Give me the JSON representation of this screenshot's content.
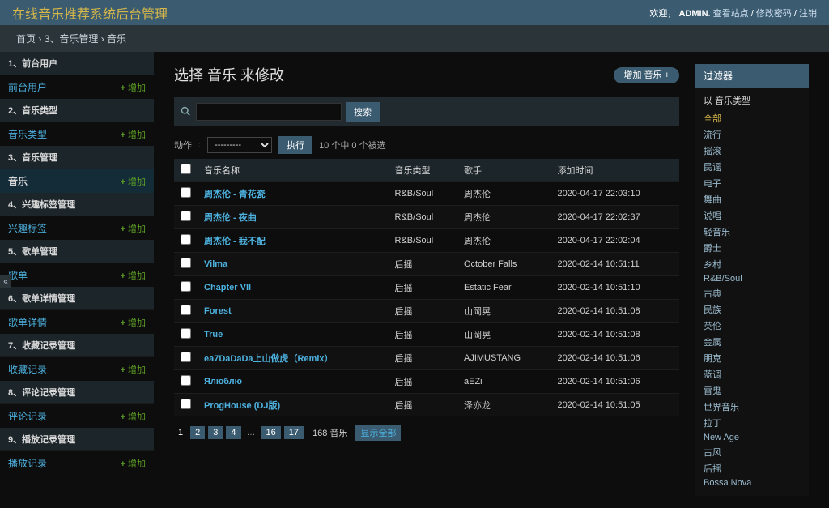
{
  "header": {
    "branding": "在线音乐推荐系统后台管理",
    "welcome": "欢迎，",
    "username": "ADMIN",
    "view_site": "查看站点",
    "change_password": "修改密码",
    "logout": "注销"
  },
  "breadcrumbs": {
    "home": "首页",
    "app": "3、音乐管理",
    "model": "音乐"
  },
  "sidebar": {
    "groups": [
      {
        "caption": "1、前台用户",
        "models": [
          {
            "name": "前台用户",
            "add": "增加"
          }
        ]
      },
      {
        "caption": "2、音乐类型",
        "models": [
          {
            "name": "音乐类型",
            "add": "增加"
          }
        ]
      },
      {
        "caption": "3、音乐管理",
        "models": [
          {
            "name": "音乐",
            "add": "增加",
            "selected": true
          }
        ]
      },
      {
        "caption": "4、兴趣标签管理",
        "models": [
          {
            "name": "兴趣标签",
            "add": "增加"
          }
        ]
      },
      {
        "caption": "5、歌单管理",
        "models": [
          {
            "name": "歌单",
            "add": "增加"
          }
        ]
      },
      {
        "caption": "6、歌单详情管理",
        "models": [
          {
            "name": "歌单详情",
            "add": "增加"
          }
        ]
      },
      {
        "caption": "7、收藏记录管理",
        "models": [
          {
            "name": "收藏记录",
            "add": "增加"
          }
        ]
      },
      {
        "caption": "8、评论记录管理",
        "models": [
          {
            "name": "评论记录",
            "add": "增加"
          }
        ]
      },
      {
        "caption": "9、播放记录管理",
        "models": [
          {
            "name": "播放记录",
            "add": "增加"
          }
        ]
      }
    ]
  },
  "content": {
    "title": "选择 音乐 来修改",
    "add_button": "增加 音乐",
    "search": {
      "placeholder": "",
      "submit": "搜索"
    },
    "actions": {
      "label": "动作",
      "blank_option": "---------",
      "go": "执行",
      "counter": "10 个中 0 个被选"
    },
    "columns": [
      "音乐名称",
      "音乐类型",
      "歌手",
      "添加时间"
    ],
    "rows": [
      {
        "name": "周杰伦 - 青花瓷",
        "type": "R&B/Soul",
        "singer": "周杰伦",
        "time": "2020-04-17 22:03:10"
      },
      {
        "name": "周杰伦 - 夜曲",
        "type": "R&B/Soul",
        "singer": "周杰伦",
        "time": "2020-04-17 22:02:37"
      },
      {
        "name": "周杰伦 - 我不配",
        "type": "R&B/Soul",
        "singer": "周杰伦",
        "time": "2020-04-17 22:02:04"
      },
      {
        "name": "Vilma",
        "type": "后摇",
        "singer": "October Falls",
        "time": "2020-02-14 10:51:11"
      },
      {
        "name": "Chapter VII",
        "type": "后摇",
        "singer": "Estatic Fear",
        "time": "2020-02-14 10:51:10"
      },
      {
        "name": "Forest",
        "type": "后摇",
        "singer": "山岡晃",
        "time": "2020-02-14 10:51:08"
      },
      {
        "name": "True",
        "type": "后摇",
        "singer": "山岡晃",
        "time": "2020-02-14 10:51:08"
      },
      {
        "name": "ea7DaDaDa上山做虎（Remix）",
        "type": "后摇",
        "singer": "AJIMUSTANG",
        "time": "2020-02-14 10:51:06"
      },
      {
        "name": "Ялюблю",
        "type": "后摇",
        "singer": "aEZi",
        "time": "2020-02-14 10:51:06"
      },
      {
        "name": "ProgHouse (DJ版)",
        "type": "后摇",
        "singer": "泽亦龙",
        "time": "2020-02-14 10:51:05"
      }
    ],
    "paginator": {
      "current": "1",
      "pages": [
        "2",
        "3",
        "4"
      ],
      "dots": "…",
      "last_pages": [
        "16",
        "17"
      ],
      "total": "168 音乐",
      "show_all": "显示全部"
    }
  },
  "filter": {
    "title": "过滤器",
    "by": "以 音乐类型",
    "options": [
      "全部",
      "流行",
      "摇滚",
      "民谣",
      "电子",
      "舞曲",
      "说唱",
      "轻音乐",
      "爵士",
      "乡村",
      "R&B/Soul",
      "古典",
      "民族",
      "英伦",
      "金属",
      "朋克",
      "蓝调",
      "雷鬼",
      "世界音乐",
      "拉丁",
      "New Age",
      "古风",
      "后摇",
      "Bossa Nova"
    ]
  }
}
